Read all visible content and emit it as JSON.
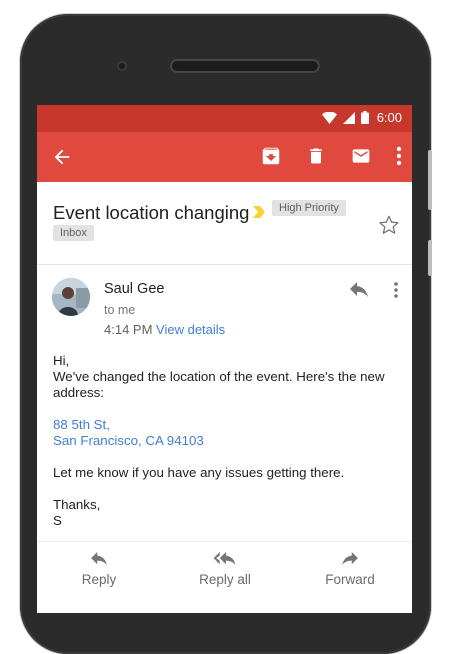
{
  "status_bar": {
    "time": "6:00"
  },
  "app_bar": {
    "back_icon": "arrow-back-icon",
    "actions": [
      "archive-icon",
      "delete-icon",
      "mail-icon",
      "more-vert-icon"
    ]
  },
  "message": {
    "subject": "Event location changing",
    "labels": {
      "priority": "High Priority",
      "inbox": "Inbox"
    },
    "sender": {
      "name": "Saul Gee",
      "to": "to me",
      "time": "4:14 PM",
      "details_link": "View details"
    },
    "body": {
      "greeting": "Hi,",
      "line1": "We've changed the location of the event. Here's the new",
      "line2": "address:",
      "address1": "88 5th St,",
      "address2": "San Francisco, CA 94103",
      "line3": "Let me know if you have any issues getting there.",
      "signoff": "Thanks,",
      "signature": "S"
    }
  },
  "footer": {
    "reply": "Reply",
    "reply_all": "Reply all",
    "forward": "Forward"
  },
  "colors": {
    "status_bar": "#c8372c",
    "app_bar": "#e0493d",
    "link": "#3f7fd2",
    "importance": "#f6d334"
  }
}
